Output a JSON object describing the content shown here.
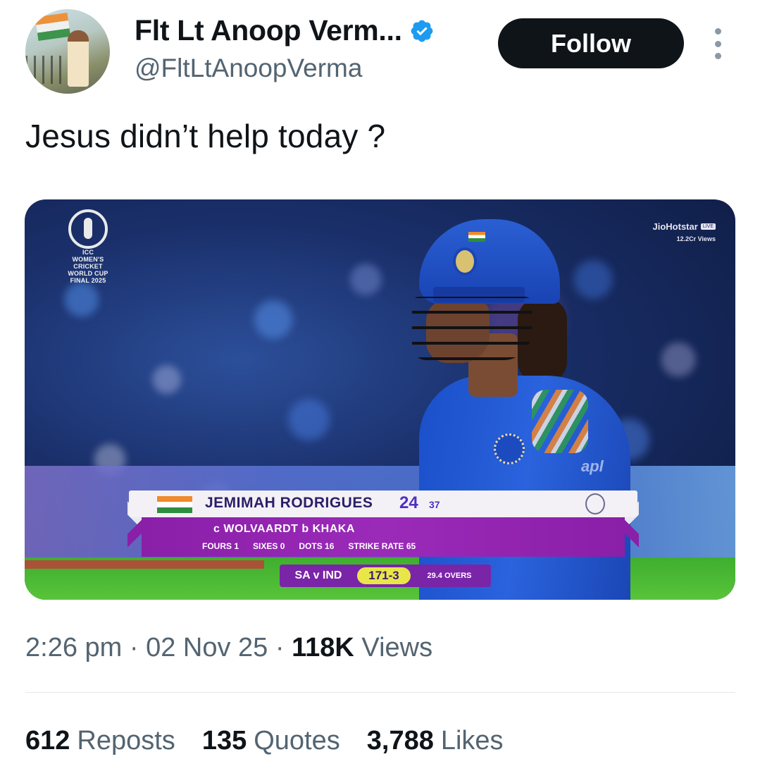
{
  "author": {
    "display_name": "Flt Lt Anoop Verm...",
    "handle": "@FltLtAnoopVerma",
    "verified_icon": "verified-badge-icon",
    "verified_color": "#1d9bf0"
  },
  "actions": {
    "follow_label": "Follow",
    "more_icon": "more-vertical-icon"
  },
  "tweet": {
    "text": "Jesus didn’t help today ?"
  },
  "media": {
    "tournament_logo": {
      "org": "ICC",
      "line1": "WOMEN'S CRICKET",
      "line2": "WORLD CUP",
      "line3": "FINAL 2025"
    },
    "broadcaster": {
      "name": "JioHotstar",
      "live": "LIVE",
      "views": "12.2Cr Views"
    },
    "scorecard": {
      "batter": "JEMIMAH RODRIGUES",
      "runs": "24",
      "balls": "37",
      "dismissal": "c  WOLVAARDT   b  KHAKA",
      "fours": "FOURS 1",
      "sixes": "SIXES 0",
      "dots": "DOTS 16",
      "strike_rate": "STRIKE RATE 65"
    },
    "scorebar": {
      "teams": "SA v IND",
      "score": "171-3",
      "overs": "29.4 OVERS"
    },
    "sponsor": "apl"
  },
  "meta": {
    "time": "2:26 pm",
    "separator": "·",
    "date": "02 Nov 25",
    "views_count": "118K",
    "views_label": "Views"
  },
  "engagement": {
    "reposts_count": "612",
    "reposts_label": "Reposts",
    "quotes_count": "135",
    "quotes_label": "Quotes",
    "likes_count": "3,788",
    "likes_label": "Likes"
  }
}
